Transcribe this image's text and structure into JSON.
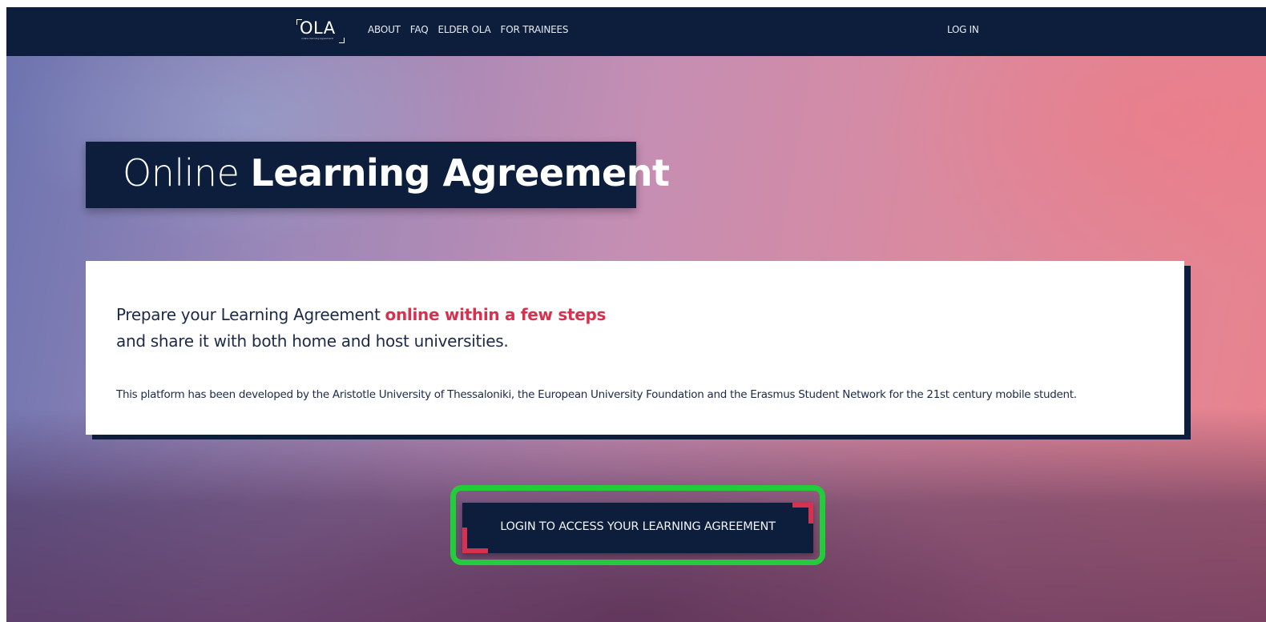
{
  "navbar": {
    "logo_text": "OLA",
    "logo_subtitle": "online learning agreement",
    "links": [
      {
        "label": "ABOUT"
      },
      {
        "label": "FAQ"
      },
      {
        "label": "ELDER OLA"
      },
      {
        "label": "FOR TRAINEES"
      }
    ],
    "login_label": "LOG IN"
  },
  "hero": {
    "title_light": "Online",
    "title_bold": "Learning Agreement"
  },
  "card": {
    "line1_prefix": "Prepare your Learning Agreement",
    "line1_highlight": "online within a few steps",
    "line2": "and share it with both home and host universities.",
    "note": "This platform has been developed by the Aristotle University of Thessaloniki, the European University Foundation and the Erasmus Student Network for the 21st century mobile student."
  },
  "cta": {
    "label": "LOGIN TO ACCESS YOUR LEARNING AGREEMENT"
  },
  "colors": {
    "navy": "#0d1d3c",
    "accent_red": "#d8304f",
    "highlight_green": "#22cc3a"
  }
}
